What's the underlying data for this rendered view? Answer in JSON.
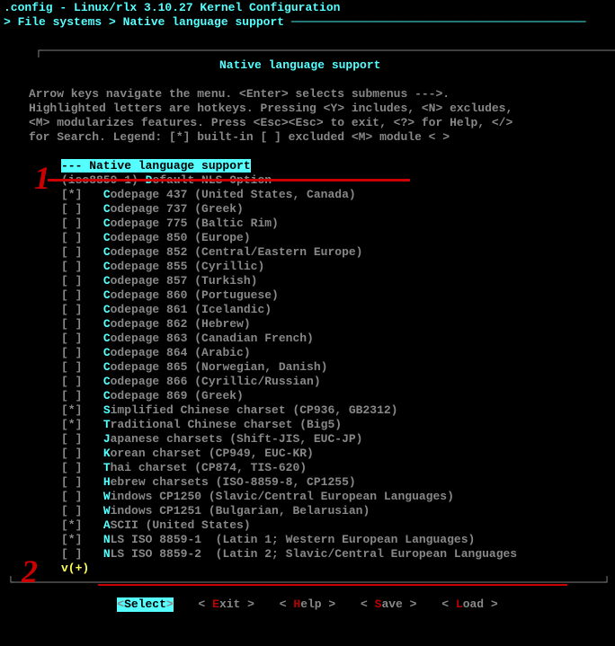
{
  "title": ".config - Linux/rlx 3.10.27 Kernel Configuration",
  "breadcrumb_prefix": "> ",
  "breadcrumb_a": "File systems",
  "breadcrumb_sep": " > ",
  "breadcrumb_b": "Native language support",
  "section_title": "Native language support",
  "help_lines": [
    "Arrow keys navigate the menu.  <Enter> selects submenus --->.",
    "Highlighted letters are hotkeys.  Pressing <Y> includes, <N> excludes,",
    "<M> modularizes features.  Press <Esc><Esc> to exit, <?> for Help, </>",
    "for Search.  Legend: [*] built-in  [ ] excluded  <M> module  < >"
  ],
  "header_row": {
    "mark": "---",
    "text": " Native language support"
  },
  "default_nls": {
    "prefix": "(iso8859-1) ",
    "hotkey": "D",
    "rest": "efault NLS Option"
  },
  "items": [
    {
      "mark": "[*]",
      "hotkey": "C",
      "rest": "odepage 437 (United States, Canada)"
    },
    {
      "mark": "[ ]",
      "hotkey": "C",
      "rest": "odepage 737 (Greek)"
    },
    {
      "mark": "[ ]",
      "hotkey": "C",
      "rest": "odepage 775 (Baltic Rim)"
    },
    {
      "mark": "[ ]",
      "hotkey": "C",
      "rest": "odepage 850 (Europe)"
    },
    {
      "mark": "[ ]",
      "hotkey": "C",
      "rest": "odepage 852 (Central/Eastern Europe)"
    },
    {
      "mark": "[ ]",
      "hotkey": "C",
      "rest": "odepage 855 (Cyrillic)"
    },
    {
      "mark": "[ ]",
      "hotkey": "C",
      "rest": "odepage 857 (Turkish)"
    },
    {
      "mark": "[ ]",
      "hotkey": "C",
      "rest": "odepage 860 (Portuguese)"
    },
    {
      "mark": "[ ]",
      "hotkey": "C",
      "rest": "odepage 861 (Icelandic)"
    },
    {
      "mark": "[ ]",
      "hotkey": "C",
      "rest": "odepage 862 (Hebrew)"
    },
    {
      "mark": "[ ]",
      "hotkey": "C",
      "rest": "odepage 863 (Canadian French)"
    },
    {
      "mark": "[ ]",
      "hotkey": "C",
      "rest": "odepage 864 (Arabic)"
    },
    {
      "mark": "[ ]",
      "hotkey": "C",
      "rest": "odepage 865 (Norwegian, Danish)"
    },
    {
      "mark": "[ ]",
      "hotkey": "C",
      "rest": "odepage 866 (Cyrillic/Russian)"
    },
    {
      "mark": "[ ]",
      "hotkey": "C",
      "rest": "odepage 869 (Greek)"
    },
    {
      "mark": "[*]",
      "hotkey": "S",
      "rest": "implified Chinese charset (CP936, GB2312)"
    },
    {
      "mark": "[*]",
      "hotkey": "T",
      "rest": "raditional Chinese charset (Big5)"
    },
    {
      "mark": "[ ]",
      "hotkey": "J",
      "rest": "apanese charsets (Shift-JIS, EUC-JP)"
    },
    {
      "mark": "[ ]",
      "hotkey": "K",
      "rest": "orean charset (CP949, EUC-KR)"
    },
    {
      "mark": "[ ]",
      "hotkey": "T",
      "rest": "hai charset (CP874, TIS-620)"
    },
    {
      "mark": "[ ]",
      "hotkey": "H",
      "rest": "ebrew charsets (ISO-8859-8, CP1255)"
    },
    {
      "mark": "[ ]",
      "hotkey": "W",
      "rest": "indows CP1250 (Slavic/Central European Languages)"
    },
    {
      "mark": "[ ]",
      "hotkey": "W",
      "rest": "indows CP1251 (Bulgarian, Belarusian)"
    },
    {
      "mark": "[*]",
      "hotkey": "A",
      "rest": "SCII (United States)"
    },
    {
      "mark": "[*]",
      "hotkey": "N",
      "rest": "LS ISO 8859-1  (Latin 1; Western European Languages)"
    },
    {
      "mark": "[ ]",
      "hotkey": "N",
      "rest": "LS ISO 8859-2  (Latin 2; Slavic/Central European Languages"
    }
  ],
  "more_indicator": "v(+)",
  "buttons": {
    "select": "Select",
    "exit_h": "E",
    "exit_r": "xit",
    "help_h": "H",
    "help_r": "elp",
    "save_h": "S",
    "save_r": "ave",
    "load_h": "L",
    "load_r": "oad"
  },
  "annotations": {
    "mark1": "1",
    "mark2": "2"
  }
}
